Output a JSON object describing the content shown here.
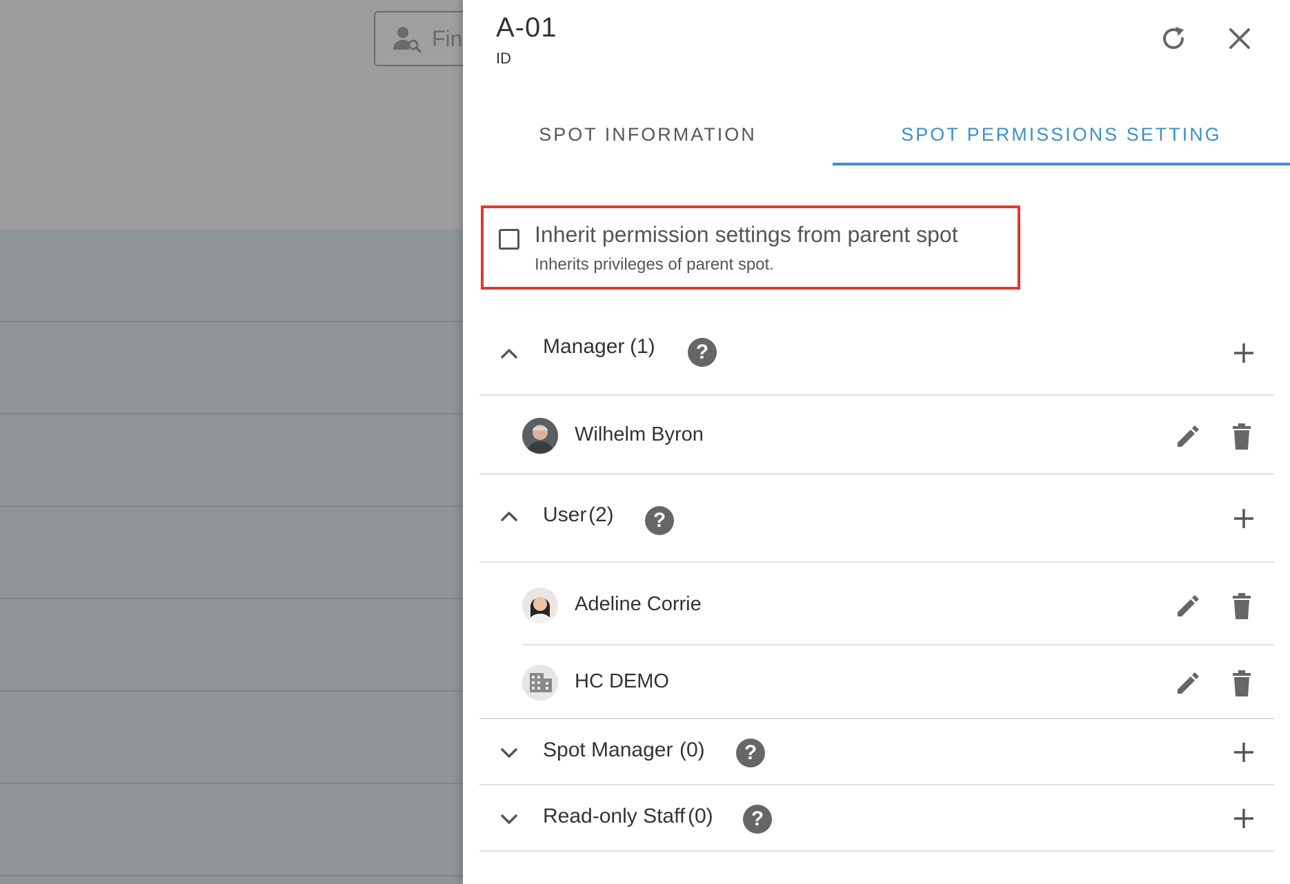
{
  "background": {
    "finder_button_label": "Fin"
  },
  "panel": {
    "title": "A-01",
    "subtitle": "ID",
    "tabs": [
      {
        "label": "SPOT INFORMATION",
        "active": false
      },
      {
        "label": "SPOT PERMISSIONS SETTING",
        "active": true
      }
    ],
    "inherit": {
      "checked": false,
      "title": "Inherit permission settings from parent spot",
      "description": "Inherits privileges of parent spot."
    },
    "groups": [
      {
        "label": "Manager",
        "count": "(1)",
        "expanded": true,
        "members": [
          {
            "name": "Wilhelm Byron",
            "avatar": "person-photo"
          }
        ]
      },
      {
        "label": "User",
        "count": "(2)",
        "expanded": true,
        "members": [
          {
            "name": "Adeline Corrie",
            "avatar": "person-photo"
          },
          {
            "name": "HC DEMO",
            "avatar": "building-icon"
          }
        ]
      },
      {
        "label": "Spot Manager",
        "count": "(0)",
        "expanded": false,
        "members": []
      },
      {
        "label": "Read-only Staff",
        "count": "(0)",
        "expanded": false,
        "members": []
      }
    ]
  },
  "colors": {
    "accent": "#3a8fd0",
    "highlight_box": "#e0392b",
    "icon_gray": "#666666"
  }
}
